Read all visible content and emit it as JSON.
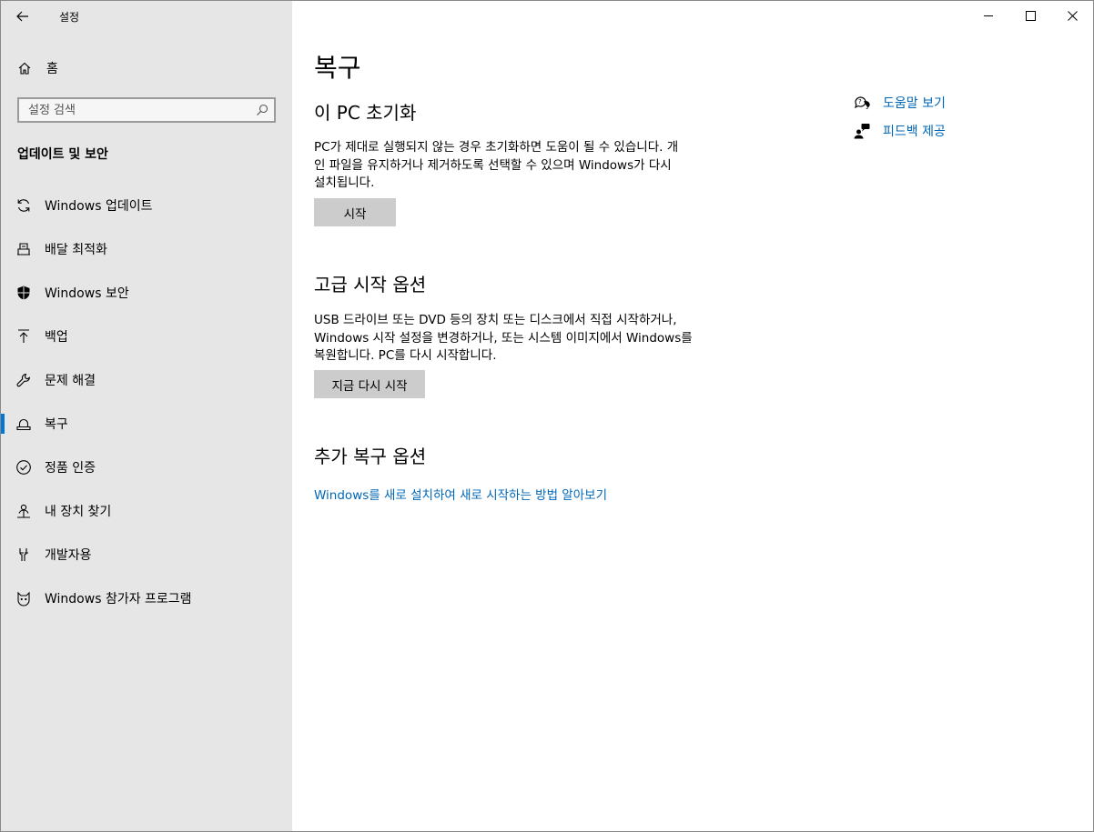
{
  "window": {
    "title": "설정",
    "back_icon": "back-arrow-icon",
    "controls": [
      "minimize",
      "maximize",
      "close"
    ]
  },
  "sidebar": {
    "home_label": "홈",
    "search_placeholder": "설정 검색",
    "section_title": "업데이트 및 보안",
    "items": [
      {
        "label": "Windows 업데이트",
        "icon": "sync-icon"
      },
      {
        "label": "배달 최적화",
        "icon": "delivery-icon"
      },
      {
        "label": "Windows 보안",
        "icon": "shield-icon"
      },
      {
        "label": "백업",
        "icon": "upload-icon"
      },
      {
        "label": "문제 해결",
        "icon": "wrench-icon"
      },
      {
        "label": "복구",
        "icon": "recovery-icon",
        "active": true
      },
      {
        "label": "정품 인증",
        "icon": "check-circle-icon"
      },
      {
        "label": "내 장치 찾기",
        "icon": "person-pin-icon"
      },
      {
        "label": "개발자용",
        "icon": "developer-icon"
      },
      {
        "label": "Windows 참가자 프로그램",
        "icon": "insider-icon"
      }
    ]
  },
  "main": {
    "title": "복구",
    "reset": {
      "heading": "이 PC 초기화",
      "description_lines": [
        "PC가 제대로 실행되지 않는 경우 초기화하면 도움이 될 수 있습니다. 개",
        "인 파일을 유지하거나 제거하도록 선택할 수 있으며 Windows가 다시",
        "설치됩니다."
      ],
      "button": "시작"
    },
    "advanced": {
      "heading": "고급 시작 옵션",
      "description_lines": [
        "USB 드라이브 또는 DVD 등의 장치 또는 디스크에서 직접 시작하거나,",
        "Windows 시작 설정을 변경하거나, 또는 시스템 이미지에서 Windows를",
        "복원합니다. PC를 다시 시작합니다."
      ],
      "button": "지금 다시 시작"
    },
    "more": {
      "heading": "추가 복구 옵션",
      "link": "Windows를 새로 설치하여 새로 시작하는 방법 알아보기"
    },
    "related": {
      "help": "도움말 보기",
      "feedback": "피드백 제공"
    }
  },
  "colors": {
    "accent": "#0078d7",
    "link": "#0067b8",
    "sidebar_bg": "#e6e6e6",
    "button_bg": "#cccccc"
  }
}
